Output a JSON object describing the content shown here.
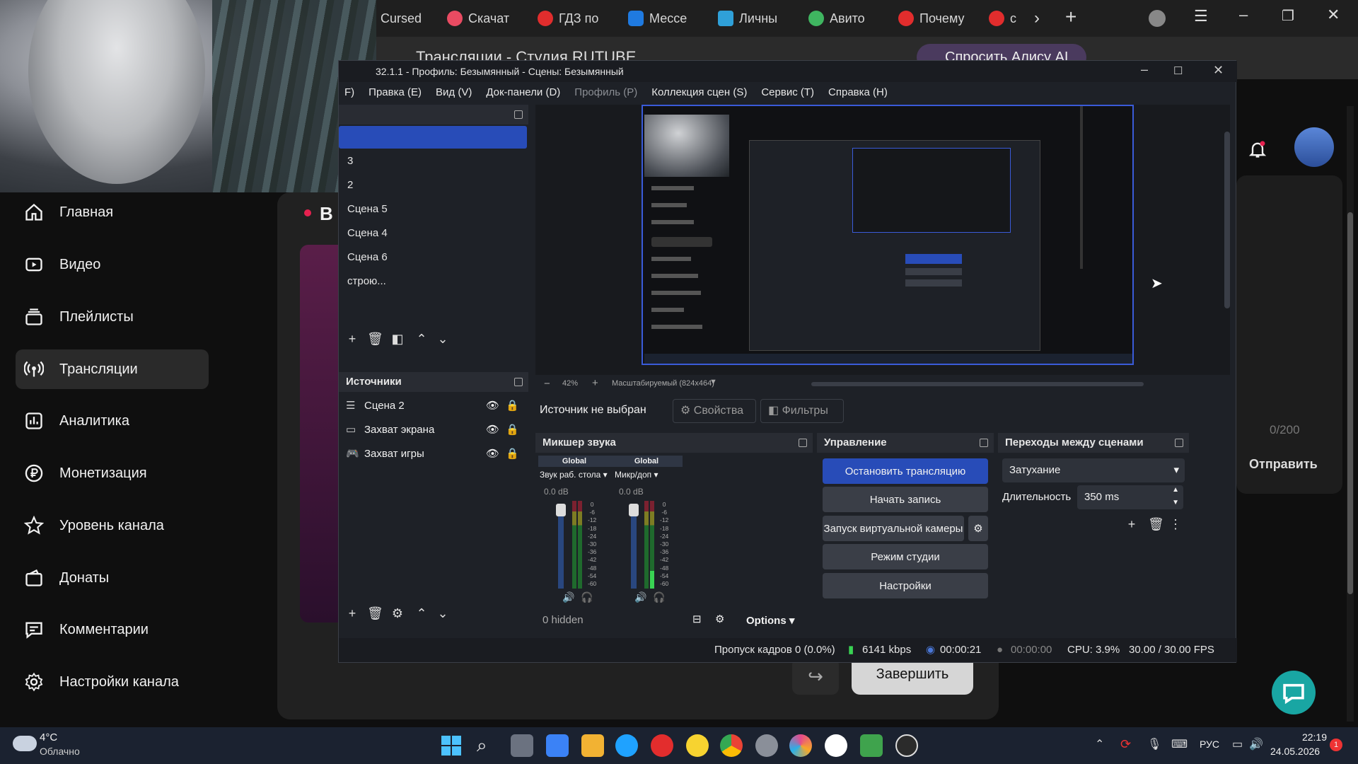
{
  "browser": {
    "tabs": [
      {
        "label": "Cursed",
        "color": "#444"
      },
      {
        "label": "Скачат",
        "color": "#e94b62"
      },
      {
        "label": "ГДЗ по",
        "color": "#e12d2d"
      },
      {
        "label": "Мессе",
        "color": "#1f7ae0"
      },
      {
        "label": "Личны",
        "color": "#2fa0d8"
      },
      {
        "label": "Авито",
        "color": "#3fb560"
      },
      {
        "label": "Почему",
        "color": "#e22d2d"
      },
      {
        "label": "с",
        "color": "#e22d2d"
      }
    ],
    "page_title": "Трансляции - Студия RUTUBE",
    "ask_alice": "Спросить Алису AI"
  },
  "studio": {
    "nav": [
      {
        "label": "Главная",
        "icon": "home-icon"
      },
      {
        "label": "Видео",
        "icon": "video-icon"
      },
      {
        "label": "Плейлисты",
        "icon": "playlist-icon"
      },
      {
        "label": "Трансляции",
        "icon": "broadcast-icon"
      },
      {
        "label": "Аналитика",
        "icon": "analytics-icon"
      },
      {
        "label": "Монетизация",
        "icon": "ruble-icon"
      },
      {
        "label": "Уровень канала",
        "icon": "star-icon"
      },
      {
        "label": "Донаты",
        "icon": "donate-icon"
      },
      {
        "label": "Комментарии",
        "icon": "comment-icon"
      },
      {
        "label": "Настройки канала",
        "icon": "settings-icon"
      }
    ],
    "live_letter": "В",
    "char_count": "0/200",
    "send_label": "Отправить",
    "finish_label": "Завершить"
  },
  "obs": {
    "title": "32.1.1 - Профиль: Безымянный - Сцены: Безымянный",
    "menu": [
      "F)",
      "Правка (E)",
      "Вид (V)",
      "Док-панели (D)",
      "Профиль (P)",
      "Коллекция сцен (S)",
      "Сервис (T)",
      "Справка (H)"
    ],
    "scenes": [
      "",
      "3",
      "2",
      "Сцена 5",
      "Сцена 4",
      "Сцена 6",
      "строю..."
    ],
    "sources_title": "Источники",
    "sources": [
      {
        "label": "Сцена 2",
        "icon": "scene-list-icon"
      },
      {
        "label": "Захват экрана",
        "icon": "monitor-icon"
      },
      {
        "label": "Захват игры",
        "icon": "gamepad-icon"
      }
    ],
    "zoom": "42%",
    "scale_mode": "Масштабируемый (824x464)",
    "no_source": "Источник не выбран",
    "properties": "Свойства",
    "filters": "Фильтры",
    "mixer": {
      "title": "Микшер звука",
      "channels": [
        {
          "tag": "Global",
          "name": "Звук раб. стола",
          "db": "0.0 dB"
        },
        {
          "tag": "Global",
          "name": "Микр/доп",
          "db": "0.0 dB"
        }
      ],
      "scale": [
        "0",
        "-6",
        "-12",
        "-18",
        "-24",
        "-30",
        "-36",
        "-42",
        "-48",
        "-54",
        "-60"
      ],
      "hidden": "0 hidden",
      "options": "Options"
    },
    "controls": {
      "title": "Управление",
      "stop_stream": "Остановить трансляцию",
      "start_record": "Начать запись",
      "virtual_cam": "Запуск виртуальной камеры",
      "studio_mode": "Режим студии",
      "settings": "Настройки"
    },
    "transitions": {
      "title": "Переходы между сценами",
      "selected": "Затухание",
      "duration_label": "Длительность",
      "duration": "350 ms"
    },
    "status": {
      "dropped": "Пропуск кадров 0 (0.0%)",
      "bitrate": "6141 kbps",
      "stream_time": "00:00:21",
      "rec_time": "00:00:00",
      "cpu": "CPU: 3.9%",
      "fps": "30.00 / 30.00 FPS"
    }
  },
  "taskbar": {
    "temp": "4°C",
    "weather": "Облачно",
    "lang": "РУС",
    "time": "22:19",
    "date": "24.05.2026",
    "notif_count": "1"
  }
}
